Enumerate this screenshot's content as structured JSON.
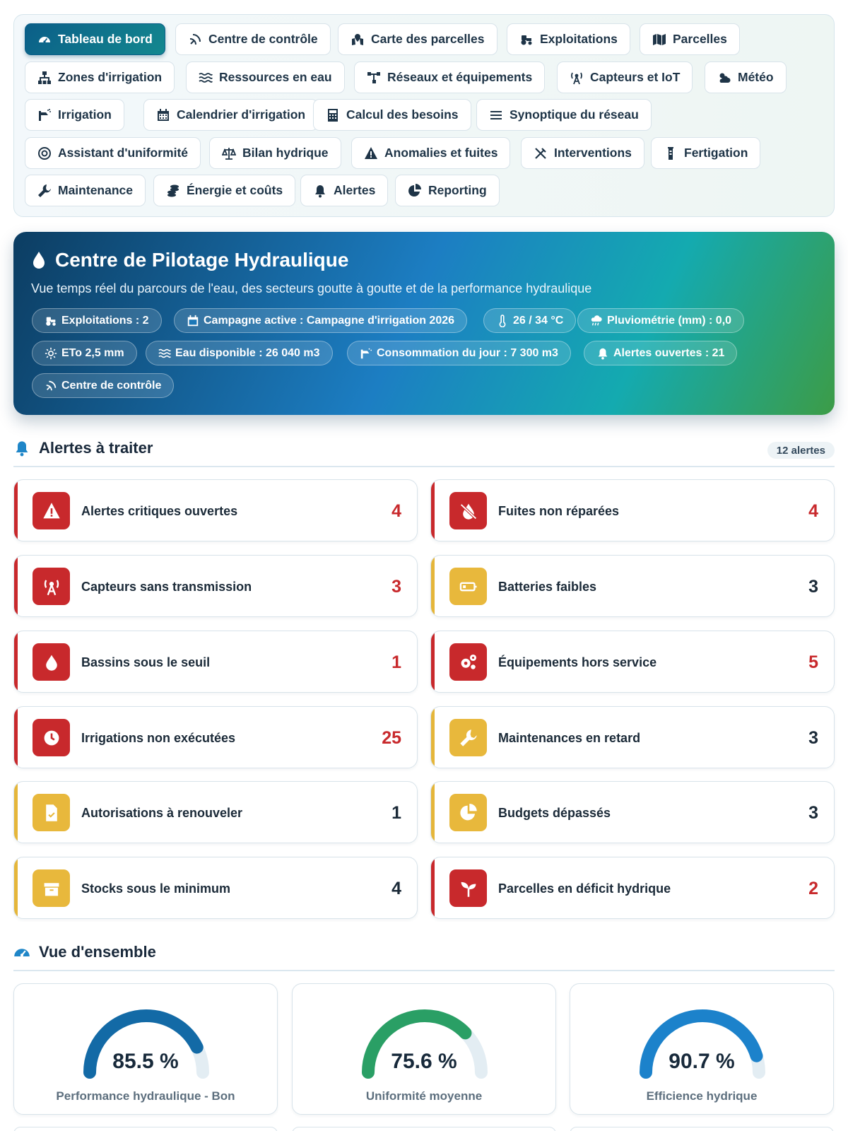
{
  "nav": {
    "items": [
      {
        "label": "Tableau de bord",
        "icon": "gauge-icon"
      },
      {
        "label": "Centre de contrôle",
        "icon": "satellite-dish-icon"
      },
      {
        "label": "Carte des parcelles",
        "icon": "map-location-icon"
      },
      {
        "label": "Exploitations",
        "icon": "tractor-icon"
      },
      {
        "label": "Parcelles",
        "icon": "map-icon"
      },
      {
        "label": "Zones d'irrigation",
        "icon": "sitemap-icon"
      },
      {
        "label": "Ressources en eau",
        "icon": "water-waves-icon"
      },
      {
        "label": "Réseaux et équipements",
        "icon": "network-icon"
      },
      {
        "label": "Capteurs et IoT",
        "icon": "tower-broadcast-icon"
      },
      {
        "label": "Météo",
        "icon": "cloud-sun-icon"
      },
      {
        "label": "Irrigation",
        "icon": "faucet-spray-icon"
      },
      {
        "label": "Calendrier d'irrigation",
        "icon": "calendar-icon"
      },
      {
        "label": "Calcul des besoins",
        "icon": "calculator-icon"
      },
      {
        "label": "Synoptique du réseau",
        "icon": "bars-icon"
      },
      {
        "label": "Assistant d'uniformité",
        "icon": "bullseye-icon"
      },
      {
        "label": "Bilan hydrique",
        "icon": "scale-balanced-icon"
      },
      {
        "label": "Anomalies et fuites",
        "icon": "warning-triangle-icon"
      },
      {
        "label": "Interventions",
        "icon": "tools-icon"
      },
      {
        "label": "Fertigation",
        "icon": "flask-icon"
      },
      {
        "label": "Maintenance",
        "icon": "wrench-icon"
      },
      {
        "label": "Énergie et coûts",
        "icon": "coins-icon"
      },
      {
        "label": "Alertes",
        "icon": "bell-icon"
      },
      {
        "label": "Reporting",
        "icon": "chart-pie-icon"
      }
    ]
  },
  "hero": {
    "title": "Centre de Pilotage Hydraulique",
    "subtitle": "Vue temps réel du parcours de l'eau, des secteurs goutte à goutte et de la performance hydraulique",
    "chips": [
      {
        "label": "Exploitations : 2",
        "icon": "tractor-icon"
      },
      {
        "label": "Campagne active : Campagne d'irrigation 2026",
        "icon": "calendar-icon"
      },
      {
        "label": "26 / 34 °C",
        "icon": "thermometer-icon"
      },
      {
        "label": "Pluviométrie (mm) : 0,0",
        "icon": "cloud-rain-icon"
      },
      {
        "label": "ETo 2,5 mm",
        "icon": "sun-icon"
      },
      {
        "label": "Eau disponible : 26 040 m3",
        "icon": "water-waves-icon"
      },
      {
        "label": "Consommation du jour : 7 300 m3",
        "icon": "faucet-spray-icon"
      },
      {
        "label": "Alertes ouvertes : 21",
        "icon": "bell-icon"
      },
      {
        "label": "Centre de contrôle",
        "icon": "satellite-dish-icon"
      }
    ]
  },
  "alerts_section": {
    "title": "Alertes à traiter",
    "badge": "12 alertes",
    "items": [
      {
        "label": "Alertes critiques ouvertes",
        "count": "4",
        "level": "red",
        "icon": "warning-triangle-icon"
      },
      {
        "label": "Fuites non réparées",
        "count": "4",
        "level": "red",
        "icon": "droplet-slash-icon"
      },
      {
        "label": "Capteurs sans transmission",
        "count": "3",
        "level": "red",
        "icon": "tower-broadcast-icon"
      },
      {
        "label": "Batteries faibles",
        "count": "3",
        "level": "yellow",
        "icon": "battery-low-icon"
      },
      {
        "label": "Bassins sous le seuil",
        "count": "1",
        "level": "red",
        "icon": "droplet-icon"
      },
      {
        "label": "Équipements hors service",
        "count": "5",
        "level": "red",
        "icon": "gears-icon"
      },
      {
        "label": "Irrigations non exécutées",
        "count": "25",
        "level": "red",
        "icon": "clock-icon"
      },
      {
        "label": "Maintenances en retard",
        "count": "3",
        "level": "yellow",
        "icon": "wrench-icon"
      },
      {
        "label": "Autorisations à renouveler",
        "count": "1",
        "level": "yellow",
        "icon": "file-contract-icon"
      },
      {
        "label": "Budgets dépassés",
        "count": "3",
        "level": "yellow",
        "icon": "chart-pie-icon"
      },
      {
        "label": "Stocks sous le minimum",
        "count": "4",
        "level": "yellow",
        "icon": "box-icon"
      },
      {
        "label": "Parcelles en déficit hydrique",
        "count": "2",
        "level": "red",
        "icon": "seedling-icon"
      }
    ]
  },
  "overview": {
    "title": "Vue d'ensemble",
    "gauges": [
      {
        "value": 85.5,
        "display": "85.5 %",
        "label": "Performance hydraulique - Bon",
        "color": "#136aa6"
      },
      {
        "value": 75.6,
        "display": "75.6 %",
        "label": "Uniformité moyenne",
        "color": "#2a9f65"
      },
      {
        "value": 90.7,
        "display": "90.7 %",
        "label": "Efficience hydrique",
        "color": "#1c82cb"
      }
    ]
  },
  "colors": {
    "critical": "#c8292c",
    "warning": "#e5b63a",
    "primary": "#0b5e88"
  }
}
